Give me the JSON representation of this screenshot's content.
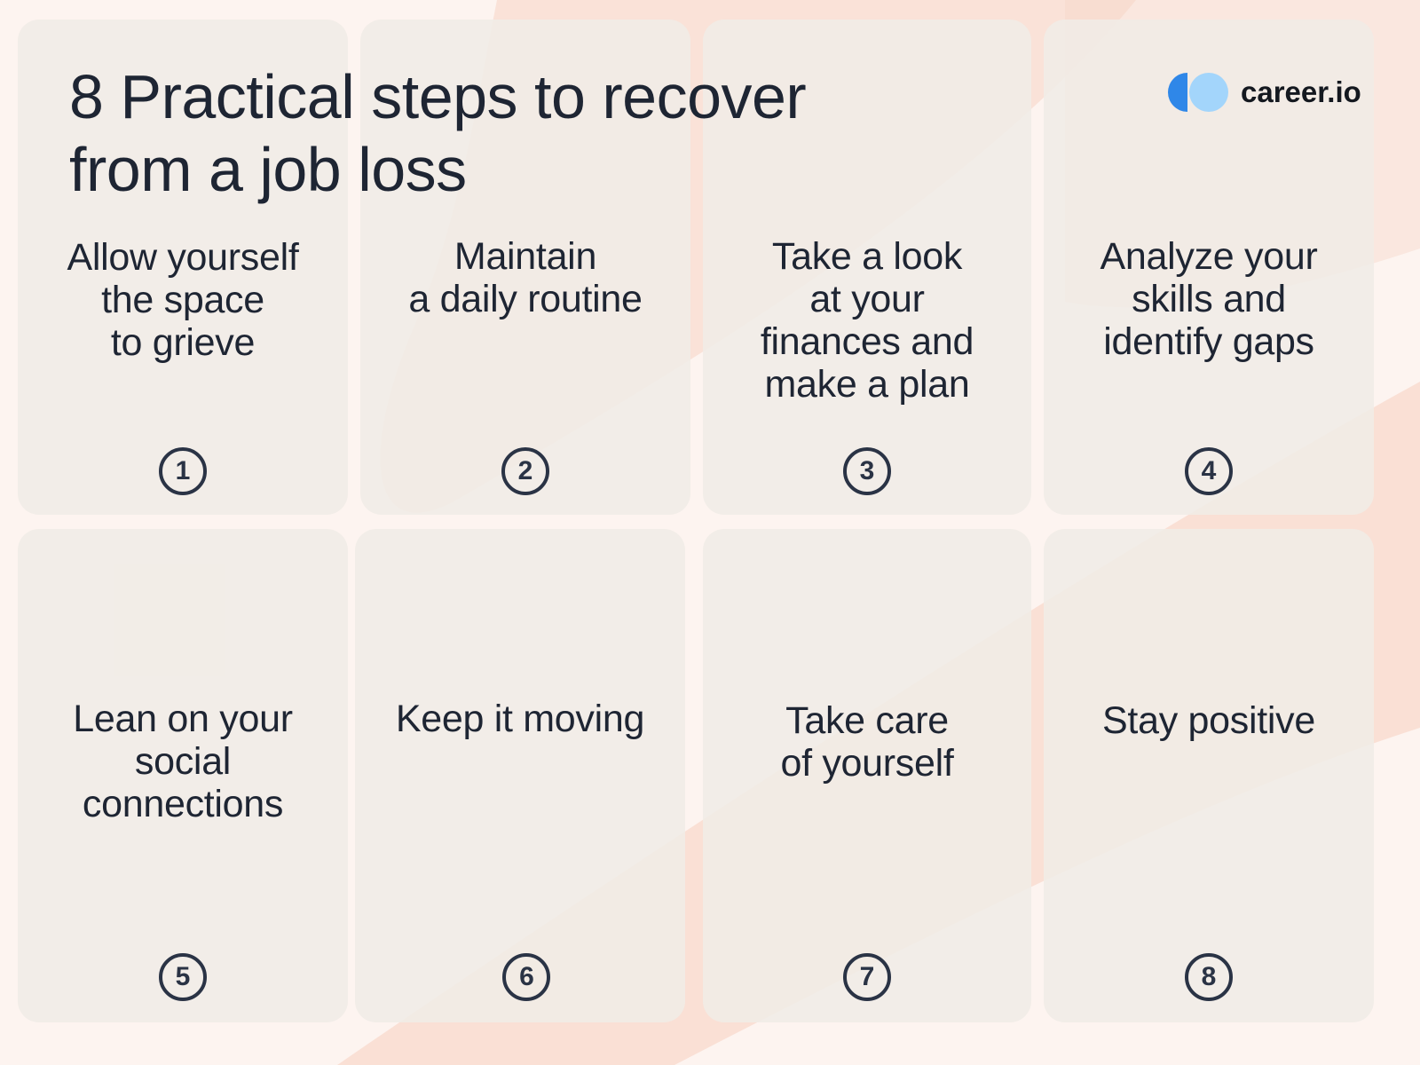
{
  "title": "8 Practical steps to recover\nfrom a job loss",
  "brand": {
    "name": "career.io",
    "icon": "career-io-logo-icon",
    "colors": {
      "dark_blue": "#2f87e8",
      "light_blue": "#a3d5fb"
    }
  },
  "colors": {
    "text": "#1e2533",
    "card": "#f0ece6",
    "background": "#fdf4f0",
    "accent_swoosh": "#f6c2b0"
  },
  "steps": [
    {
      "number": "1",
      "label": "Allow yourself\nthe space\nto grieve"
    },
    {
      "number": "2",
      "label": "Maintain\na daily routine"
    },
    {
      "number": "3",
      "label": "Take a look\nat your\nfinances and\nmake a plan"
    },
    {
      "number": "4",
      "label": "Analyze your\nskills and\nidentify gaps"
    },
    {
      "number": "5",
      "label": "Lean on your\nsocial\nconnections"
    },
    {
      "number": "6",
      "label": "Keep it moving"
    },
    {
      "number": "7",
      "label": "Take care\nof yourself"
    },
    {
      "number": "8",
      "label": "Stay positive"
    }
  ]
}
